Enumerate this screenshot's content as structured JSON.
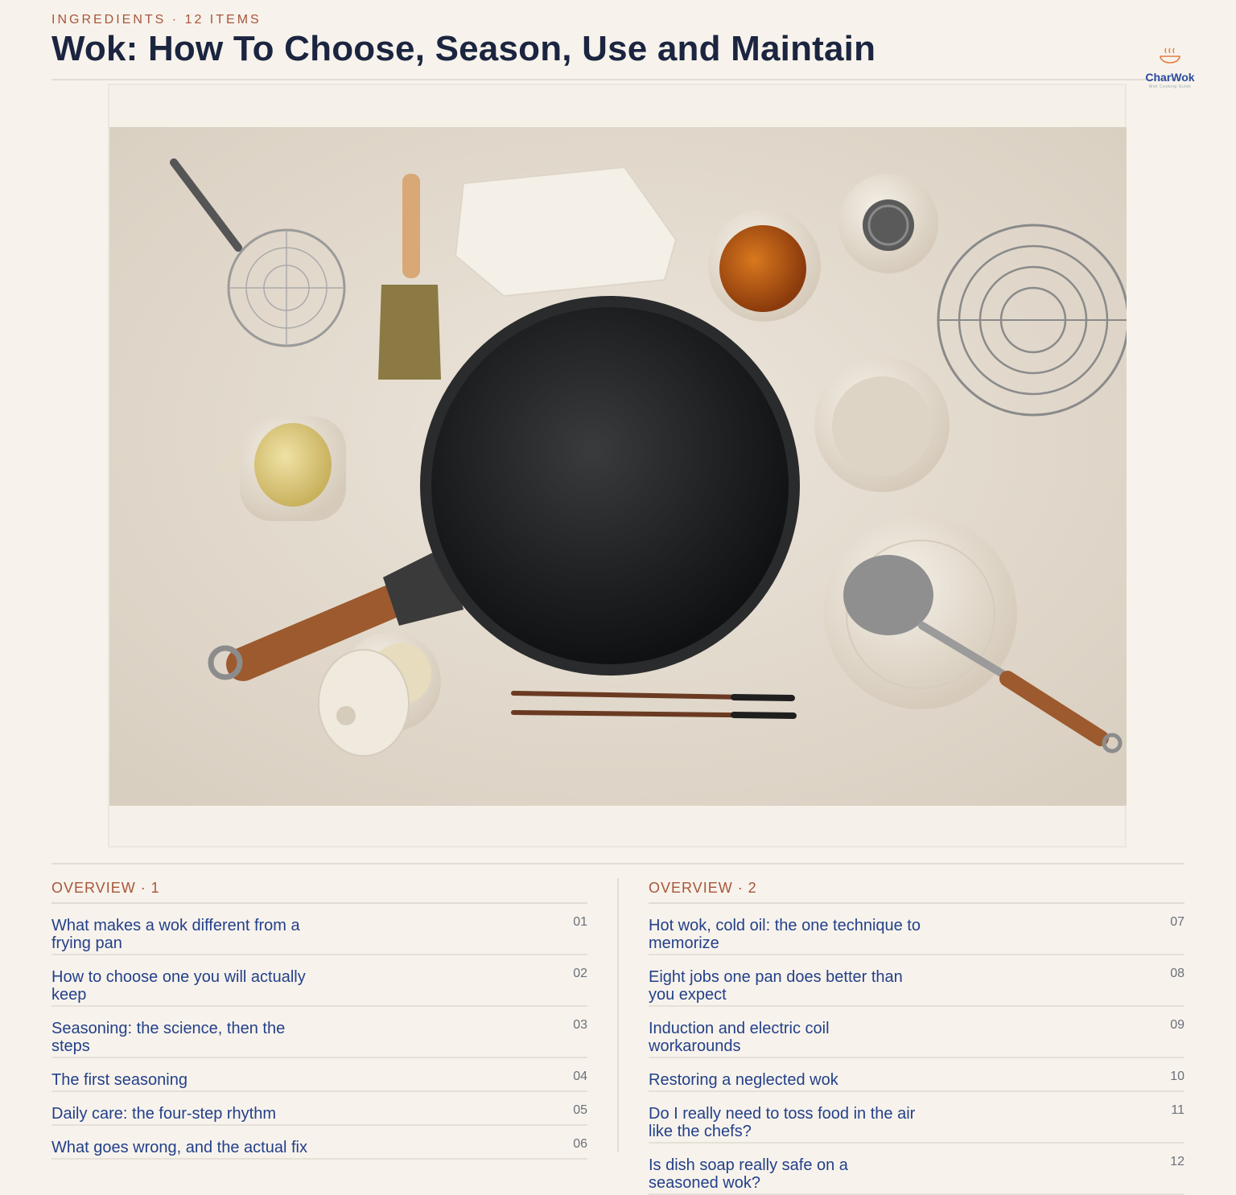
{
  "header": {
    "eyebrow": "INGREDIENTS · 12 ITEMS",
    "title": "Wok: How To Choose, Season, Use and Maintain"
  },
  "brand": {
    "name": "CharWok",
    "tagline": "Wok Cooking Guide",
    "accent": "#e77b3f",
    "primary": "#2b4aa0"
  },
  "hero_image": {
    "subject": "flat-lay of carbon steel wok with tools and bowls"
  },
  "overview": [
    {
      "heading": "OVERVIEW · 1",
      "items": [
        {
          "title": "What makes a wok different from a frying pan",
          "num": "01"
        },
        {
          "title": "How to choose one you will actually keep",
          "num": "02"
        },
        {
          "title": "Seasoning: the science, then the steps",
          "num": "03"
        },
        {
          "title": "The first seasoning",
          "num": "04"
        },
        {
          "title": "Daily care: the four-step rhythm",
          "num": "05"
        },
        {
          "title": "What goes wrong, and the actual fix",
          "num": "06"
        }
      ]
    },
    {
      "heading": "OVERVIEW · 2",
      "items": [
        {
          "title": "Hot wok, cold oil: the one technique to memorize",
          "num": "07"
        },
        {
          "title": "Eight jobs one pan does better than you expect",
          "num": "08"
        },
        {
          "title": "Induction and electric coil workarounds",
          "num": "09"
        },
        {
          "title": "Restoring a neglected wok",
          "num": "10"
        },
        {
          "title": "Do I really need to toss food in the air like the chefs?",
          "num": "11"
        },
        {
          "title": "Is dish soap really safe on a seasoned wok?",
          "num": "12"
        }
      ]
    }
  ],
  "colors": {
    "background": "#f7f3ec",
    "eyebrow": "#a8553a",
    "title": "#1b2540",
    "link": "#24408a"
  }
}
